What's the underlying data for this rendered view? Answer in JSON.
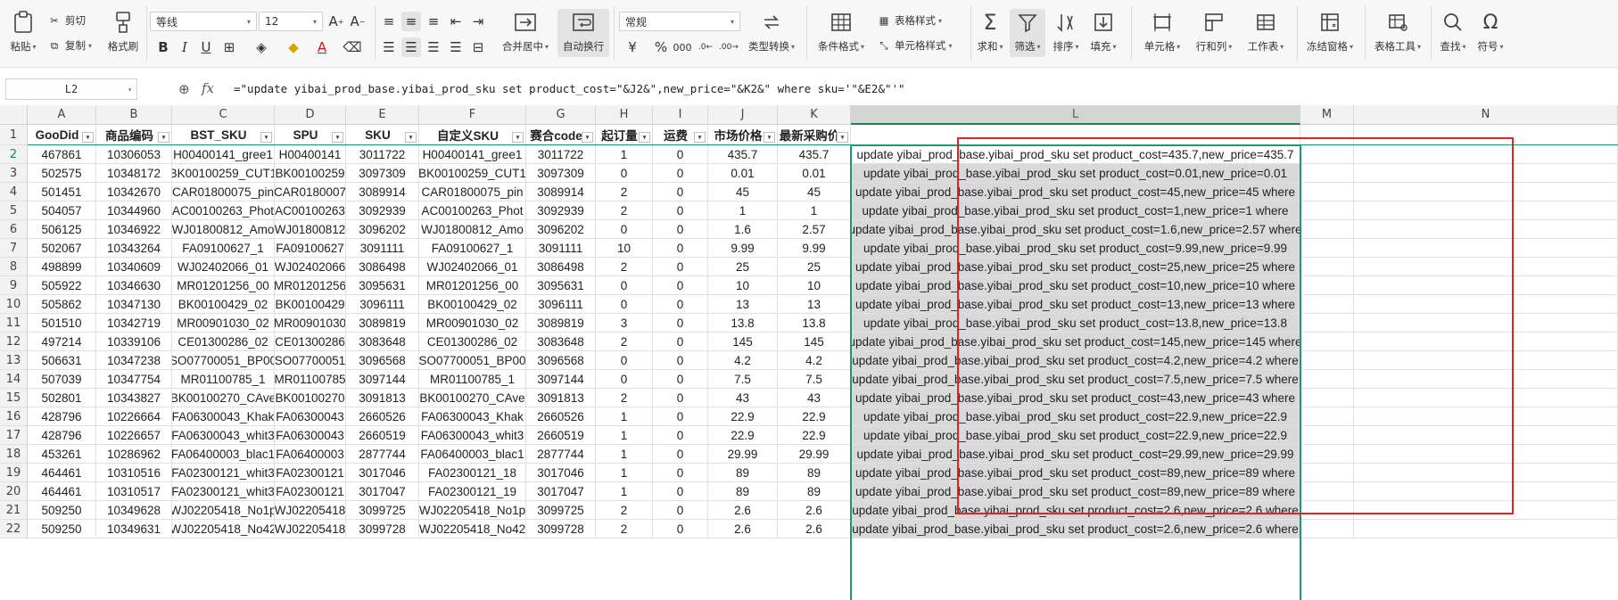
{
  "ribbon": {
    "paste": "粘贴",
    "cut": "剪切",
    "copy": "复制",
    "format_painter": "格式刷",
    "font_name": "等线",
    "font_size": "12",
    "merge_center": "合并居中",
    "wrap_text": "自动换行",
    "number_format": "常规",
    "type_convert": "类型转换",
    "conditional_format": "条件格式",
    "table_style": "表格样式",
    "cell_style": "单元格样式",
    "sum": "求和",
    "filter": "筛选",
    "sort": "排序",
    "fill": "填充",
    "cell": "单元格",
    "row_col": "行和列",
    "worksheet": "工作表",
    "freeze": "冻结窗格",
    "table_tools": "表格工具",
    "find": "查找",
    "symbol": "符号"
  },
  "formula_bar": {
    "name_box": "L2",
    "fx": "fx",
    "formula": "=\"update yibai_prod_base.yibai_prod_sku set product_cost=\"&J2&\",new_price=\"&K2&\" where sku='\"&E2&\"'\""
  },
  "columns": [
    "A",
    "B",
    "C",
    "D",
    "E",
    "F",
    "G",
    "H",
    "I",
    "J",
    "K",
    "L",
    "M",
    "N"
  ],
  "header_row": [
    "GooDid",
    "商品编码",
    "BST_SKU",
    "SPU",
    "SKU",
    "自定义SKU",
    "赛合code",
    "起订量",
    "运费",
    "市场价格",
    "最新采购价",
    ""
  ],
  "rows": [
    {
      "n": "2",
      "a": "467861",
      "b": "10306053",
      "c": "H00400141_gree1",
      "d": "H00400141",
      "e": "3011722",
      "f": "H00400141_gree1",
      "g": "3011722",
      "h": "1",
      "i": "0",
      "j": "435.7",
      "k": "435.7",
      "l": "update yibai_prod_base.yibai_prod_sku set product_cost=435.7,new_price=435.7"
    },
    {
      "n": "3",
      "a": "502575",
      "b": "10348172",
      "c": "BK00100259_CUT1",
      "d": "BK00100259",
      "e": "3097309",
      "f": "BK00100259_CUT1",
      "g": "3097309",
      "h": "0",
      "i": "0",
      "j": "0.01",
      "k": "0.01",
      "l": "update yibai_prod_base.yibai_prod_sku set product_cost=0.01,new_price=0.01"
    },
    {
      "n": "4",
      "a": "501451",
      "b": "10342670",
      "c": "CAR01800075_pin",
      "d": "CAR0180007",
      "e": "3089914",
      "f": "CAR01800075_pin",
      "g": "3089914",
      "h": "2",
      "i": "0",
      "j": "45",
      "k": "45",
      "l": "update yibai_prod_base.yibai_prod_sku set product_cost=45,new_price=45 where"
    },
    {
      "n": "5",
      "a": "504057",
      "b": "10344960",
      "c": "AC00100263_Phot",
      "d": "AC00100263",
      "e": "3092939",
      "f": "AC00100263_Phot",
      "g": "3092939",
      "h": "2",
      "i": "0",
      "j": "1",
      "k": "1",
      "l": "update yibai_prod_base.yibai_prod_sku set product_cost=1,new_price=1 where"
    },
    {
      "n": "6",
      "a": "506125",
      "b": "10346922",
      "c": "WJ01800812_Amo",
      "d": "WJ01800812",
      "e": "3096202",
      "f": "WJ01800812_Amo",
      "g": "3096202",
      "h": "0",
      "i": "0",
      "j": "1.6",
      "k": "2.57",
      "l": "update yibai_prod_base.yibai_prod_sku set product_cost=1.6,new_price=2.57 where"
    },
    {
      "n": "7",
      "a": "502067",
      "b": "10343264",
      "c": "FA09100627_1",
      "d": "FA09100627",
      "e": "3091111",
      "f": "FA09100627_1",
      "g": "3091111",
      "h": "10",
      "i": "0",
      "j": "9.99",
      "k": "9.99",
      "l": "update yibai_prod_base.yibai_prod_sku set product_cost=9.99,new_price=9.99"
    },
    {
      "n": "8",
      "a": "498899",
      "b": "10340609",
      "c": "WJ02402066_01",
      "d": "WJ02402066",
      "e": "3086498",
      "f": "WJ02402066_01",
      "g": "3086498",
      "h": "2",
      "i": "0",
      "j": "25",
      "k": "25",
      "l": "update yibai_prod_base.yibai_prod_sku set product_cost=25,new_price=25 where"
    },
    {
      "n": "9",
      "a": "505922",
      "b": "10346630",
      "c": "MR01201256_00",
      "d": "MR01201256",
      "e": "3095631",
      "f": "MR01201256_00",
      "g": "3095631",
      "h": "0",
      "i": "0",
      "j": "10",
      "k": "10",
      "l": "update yibai_prod_base.yibai_prod_sku set product_cost=10,new_price=10 where"
    },
    {
      "n": "10",
      "a": "505862",
      "b": "10347130",
      "c": "BK00100429_02",
      "d": "BK00100429",
      "e": "3096111",
      "f": "BK00100429_02",
      "g": "3096111",
      "h": "0",
      "i": "0",
      "j": "13",
      "k": "13",
      "l": "update yibai_prod_base.yibai_prod_sku set product_cost=13,new_price=13 where"
    },
    {
      "n": "11",
      "a": "501510",
      "b": "10342719",
      "c": "MR00901030_02",
      "d": "MR00901030",
      "e": "3089819",
      "f": "MR00901030_02",
      "g": "3089819",
      "h": "3",
      "i": "0",
      "j": "13.8",
      "k": "13.8",
      "l": "update yibai_prod_base.yibai_prod_sku set product_cost=13.8,new_price=13.8"
    },
    {
      "n": "12",
      "a": "497214",
      "b": "10339106",
      "c": "CE01300286_02",
      "d": "CE01300286",
      "e": "3083648",
      "f": "CE01300286_02",
      "g": "3083648",
      "h": "2",
      "i": "0",
      "j": "145",
      "k": "145",
      "l": "update yibai_prod_base.yibai_prod_sku set product_cost=145,new_price=145 where"
    },
    {
      "n": "13",
      "a": "506631",
      "b": "10347238",
      "c": "SO07700051_BP00",
      "d": "SO07700051",
      "e": "3096568",
      "f": "SO07700051_BP00",
      "g": "3096568",
      "h": "0",
      "i": "0",
      "j": "4.2",
      "k": "4.2",
      "l": "update yibai_prod_base.yibai_prod_sku set product_cost=4.2,new_price=4.2 where"
    },
    {
      "n": "14",
      "a": "507039",
      "b": "10347754",
      "c": "MR01100785_1",
      "d": "MR01100785",
      "e": "3097144",
      "f": "MR01100785_1",
      "g": "3097144",
      "h": "0",
      "i": "0",
      "j": "7.5",
      "k": "7.5",
      "l": "update yibai_prod_base.yibai_prod_sku set product_cost=7.5,new_price=7.5 where"
    },
    {
      "n": "15",
      "a": "502801",
      "b": "10343827",
      "c": "BK00100270_CAve",
      "d": "BK00100270",
      "e": "3091813",
      "f": "BK00100270_CAve",
      "g": "3091813",
      "h": "2",
      "i": "0",
      "j": "43",
      "k": "43",
      "l": "update yibai_prod_base.yibai_prod_sku set product_cost=43,new_price=43 where"
    },
    {
      "n": "16",
      "a": "428796",
      "b": "10226664",
      "c": "FA06300043_Khak",
      "d": "FA06300043",
      "e": "2660526",
      "f": "FA06300043_Khak",
      "g": "2660526",
      "h": "1",
      "i": "0",
      "j": "22.9",
      "k": "22.9",
      "l": "update yibai_prod_base.yibai_prod_sku set product_cost=22.9,new_price=22.9"
    },
    {
      "n": "17",
      "a": "428796",
      "b": "10226657",
      "c": "FA06300043_whit3",
      "d": "FA06300043",
      "e": "2660519",
      "f": "FA06300043_whit3",
      "g": "2660519",
      "h": "1",
      "i": "0",
      "j": "22.9",
      "k": "22.9",
      "l": "update yibai_prod_base.yibai_prod_sku set product_cost=22.9,new_price=22.9"
    },
    {
      "n": "18",
      "a": "453261",
      "b": "10286962",
      "c": "FA06400003_blac1",
      "d": "FA06400003",
      "e": "2877744",
      "f": "FA06400003_blac1",
      "g": "2877744",
      "h": "1",
      "i": "0",
      "j": "29.99",
      "k": "29.99",
      "l": "update yibai_prod_base.yibai_prod_sku set product_cost=29.99,new_price=29.99"
    },
    {
      "n": "19",
      "a": "464461",
      "b": "10310516",
      "c": "FA02300121_whit3",
      "d": "FA02300121",
      "e": "3017046",
      "f": "FA02300121_18",
      "g": "3017046",
      "h": "1",
      "i": "0",
      "j": "89",
      "k": "89",
      "l": "update yibai_prod_base.yibai_prod_sku set product_cost=89,new_price=89 where"
    },
    {
      "n": "20",
      "a": "464461",
      "b": "10310517",
      "c": "FA02300121_whit3",
      "d": "FA02300121",
      "e": "3017047",
      "f": "FA02300121_19",
      "g": "3017047",
      "h": "1",
      "i": "0",
      "j": "89",
      "k": "89",
      "l": "update yibai_prod_base.yibai_prod_sku set product_cost=89,new_price=89 where"
    },
    {
      "n": "21",
      "a": "509250",
      "b": "10349628",
      "c": "WJ02205418_No1p",
      "d": "WJ02205418",
      "e": "3099725",
      "f": "WJ02205418_No1p",
      "g": "3099725",
      "h": "2",
      "i": "0",
      "j": "2.6",
      "k": "2.6",
      "l": "update yibai_prod_base.yibai_prod_sku set product_cost=2.6,new_price=2.6 where"
    },
    {
      "n": "22",
      "a": "509250",
      "b": "10349631",
      "c": "WJ02205418_No42",
      "d": "WJ02205418",
      "e": "3099728",
      "f": "WJ02205418_No42",
      "g": "3099728",
      "h": "2",
      "i": "0",
      "j": "2.6",
      "k": "2.6",
      "l": "update yibai_prod_base.yibai_prod_sku set product_cost=2.6,new_price=2.6 where"
    }
  ]
}
